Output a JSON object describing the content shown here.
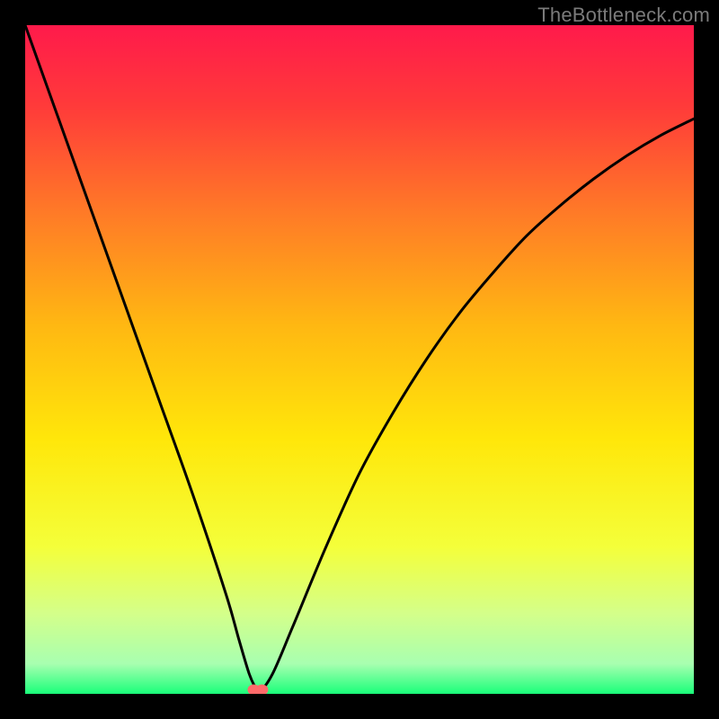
{
  "watermark": "TheBottleneck.com",
  "chart_data": {
    "type": "line",
    "title": "",
    "xlabel": "",
    "ylabel": "",
    "xlim": [
      0,
      100
    ],
    "ylim": [
      0,
      100
    ],
    "background_gradient": {
      "stops": [
        {
          "pos": 0.0,
          "color": "#ff1a4b"
        },
        {
          "pos": 0.12,
          "color": "#ff3a3a"
        },
        {
          "pos": 0.28,
          "color": "#ff7a27"
        },
        {
          "pos": 0.45,
          "color": "#ffb812"
        },
        {
          "pos": 0.62,
          "color": "#ffe70a"
        },
        {
          "pos": 0.78,
          "color": "#f4ff3a"
        },
        {
          "pos": 0.88,
          "color": "#d4ff8a"
        },
        {
          "pos": 0.955,
          "color": "#a8ffb0"
        },
        {
          "pos": 1.0,
          "color": "#1aff7a"
        }
      ]
    },
    "series": [
      {
        "name": "bottleneck-curve",
        "color": "#000000",
        "x": [
          0,
          5,
          10,
          15,
          20,
          25,
          30,
          32,
          33.5,
          34.5,
          35,
          37,
          40,
          45,
          50,
          55,
          60,
          65,
          70,
          75,
          80,
          85,
          90,
          95,
          100
        ],
        "y": [
          100,
          86,
          72,
          58,
          44,
          30,
          15,
          8,
          3,
          0.8,
          0.2,
          3,
          10,
          22,
          33,
          42,
          50,
          57,
          63,
          68.5,
          73,
          77,
          80.5,
          83.5,
          86
        ]
      }
    ],
    "markers": [
      {
        "name": "highlight-marker-1",
        "x": 34.2,
        "y": 0.6,
        "color": "#ff6a6a"
      },
      {
        "name": "highlight-marker-2",
        "x": 35.4,
        "y": 0.6,
        "color": "#ff6a6a"
      }
    ]
  }
}
